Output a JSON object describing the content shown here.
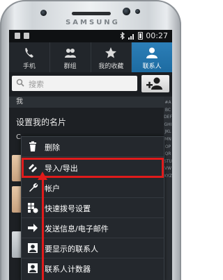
{
  "device": {
    "brand": "SAMSUNG"
  },
  "status_bar": {
    "time": "00:27"
  },
  "tabs": [
    {
      "label": "手机",
      "icon": "phone-icon",
      "active": false
    },
    {
      "label": "群组",
      "icon": "group-icon",
      "active": false
    },
    {
      "label": "我的收藏",
      "icon": "star-icon",
      "active": false
    },
    {
      "label": "联系人",
      "icon": "person-icon",
      "active": true
    }
  ],
  "search": {
    "placeholder": "搜索"
  },
  "contacts": {
    "section_me": "我",
    "my_card_label": "设置我的名片",
    "letter_c": "C"
  },
  "index_letters": "#ABCDEFGHIJKLMNOPQRSTUVWXYZ",
  "menu": {
    "items": [
      {
        "label": "删除",
        "icon": "trash-icon"
      },
      {
        "label": "导入/导出",
        "icon": "import-export-icon",
        "highlighted": true
      },
      {
        "label": "帐户",
        "icon": "wrench-icon"
      },
      {
        "label": "快速拨号设置",
        "icon": "speed-dial-icon"
      },
      {
        "label": "发送信息/电子邮件",
        "icon": "send-arrow-icon"
      },
      {
        "label": "要显示的联系人",
        "icon": "contact-card-icon"
      },
      {
        "label": "联系人计数器",
        "icon": "contact-counter-icon"
      }
    ]
  },
  "colors": {
    "accent_tab": "#1d6ba1",
    "annotation_red": "#e01b1b"
  }
}
